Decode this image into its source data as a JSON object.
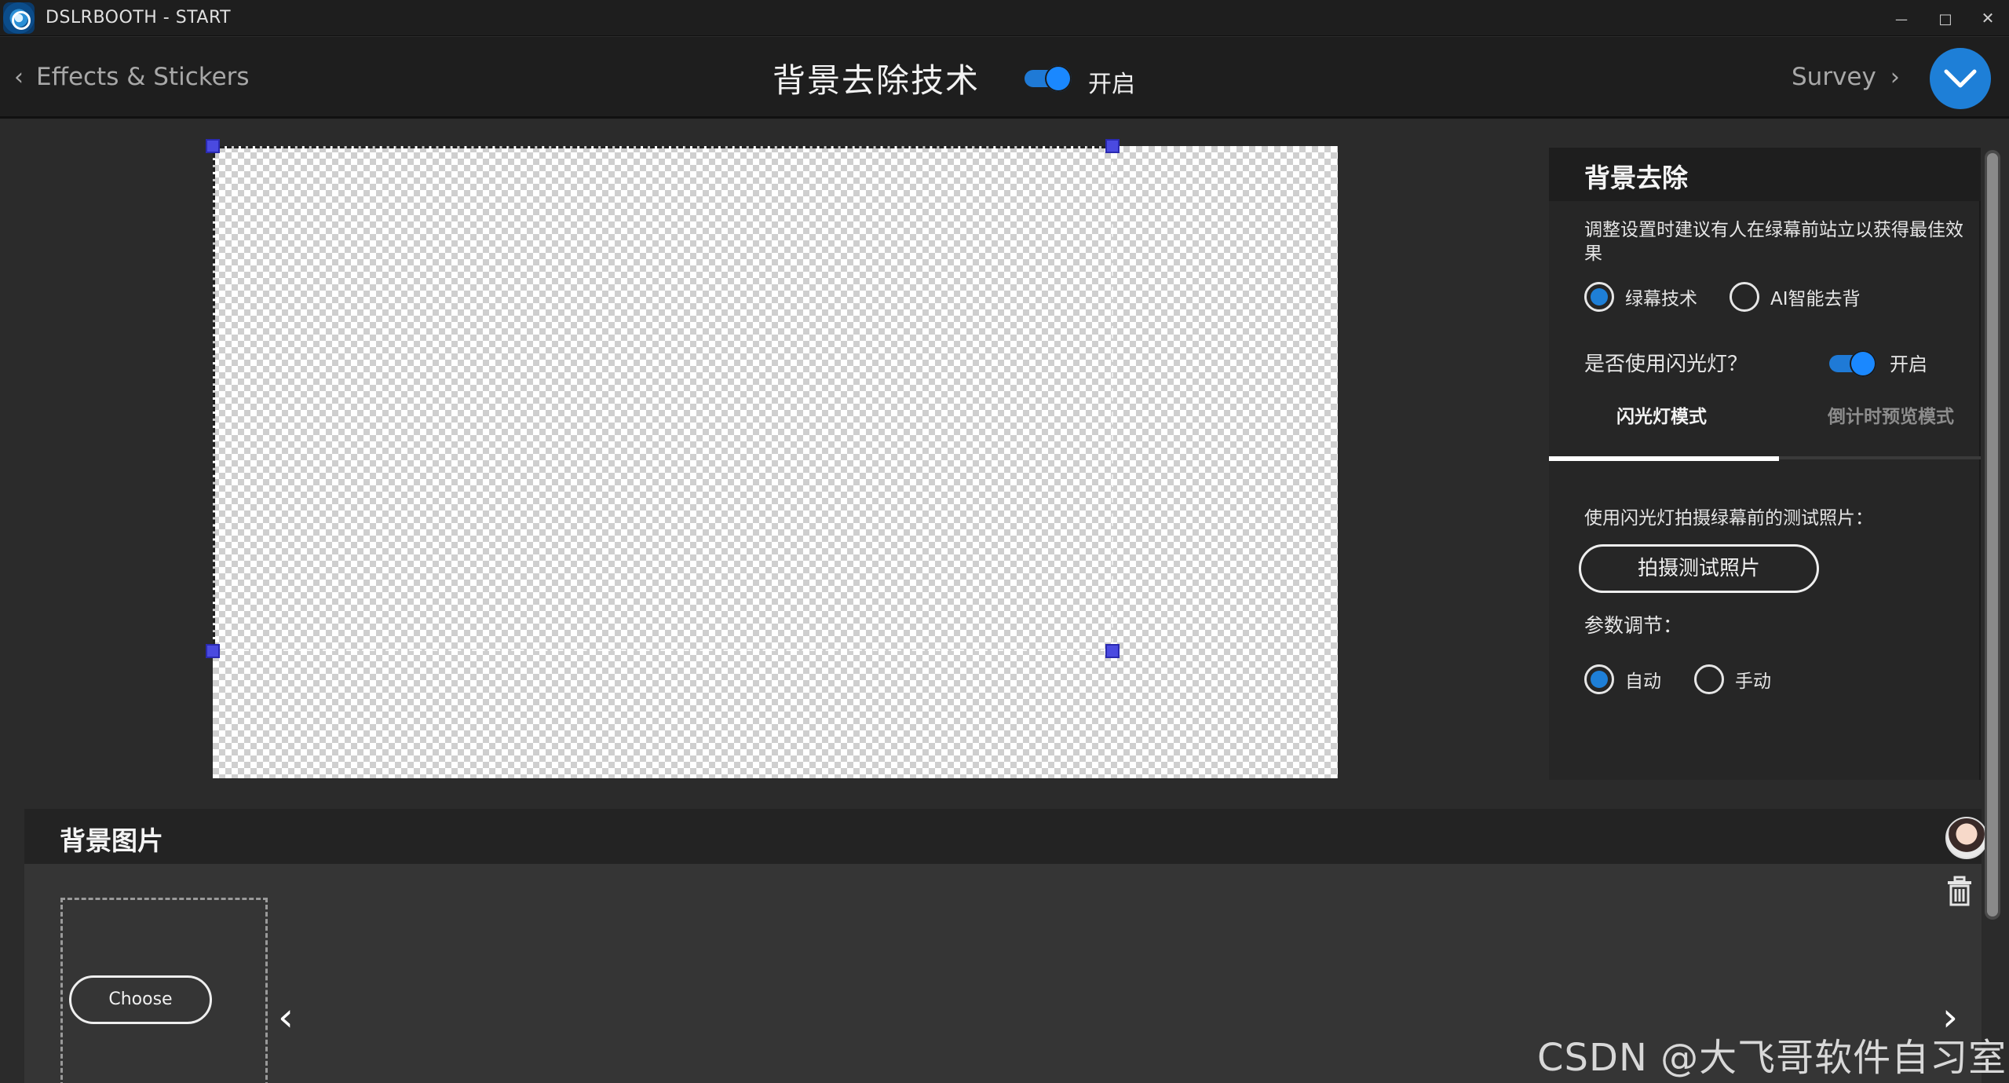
{
  "window": {
    "title": "DSLRBOOTH - START",
    "controls": {
      "minimize": "—",
      "maximize": "□",
      "close": "✕"
    }
  },
  "header": {
    "back_label": "Effects & Stickers",
    "title": "背景去除技术",
    "toggle_label": "开启",
    "forward_label": "Survey",
    "accent_color": "#1e7fd7"
  },
  "panel": {
    "title": "背景去除",
    "hint": "调整设置时建议有人在绿幕前站立以获得最佳效果",
    "method_options": [
      {
        "label": "绿幕技术",
        "selected": true
      },
      {
        "label": "AI智能去背",
        "selected": false
      }
    ],
    "flash_question": "是否使用闪光灯？",
    "flash_toggle_label": "开启",
    "tabs": [
      {
        "label": "闪光灯模式",
        "active": true
      },
      {
        "label": "倒计时预览模式",
        "active": false
      }
    ],
    "test_photo_label": "使用闪光灯拍摄绿幕前的测试照片：",
    "test_photo_button": "拍摄测试照片",
    "param_label": "参数调节：",
    "param_options": [
      {
        "label": "自动",
        "selected": true
      },
      {
        "label": "手动",
        "selected": false
      }
    ]
  },
  "background_images": {
    "title": "背景图片",
    "choose_button": "Choose"
  },
  "watermark": "CSDN @大飞哥软件自习室"
}
